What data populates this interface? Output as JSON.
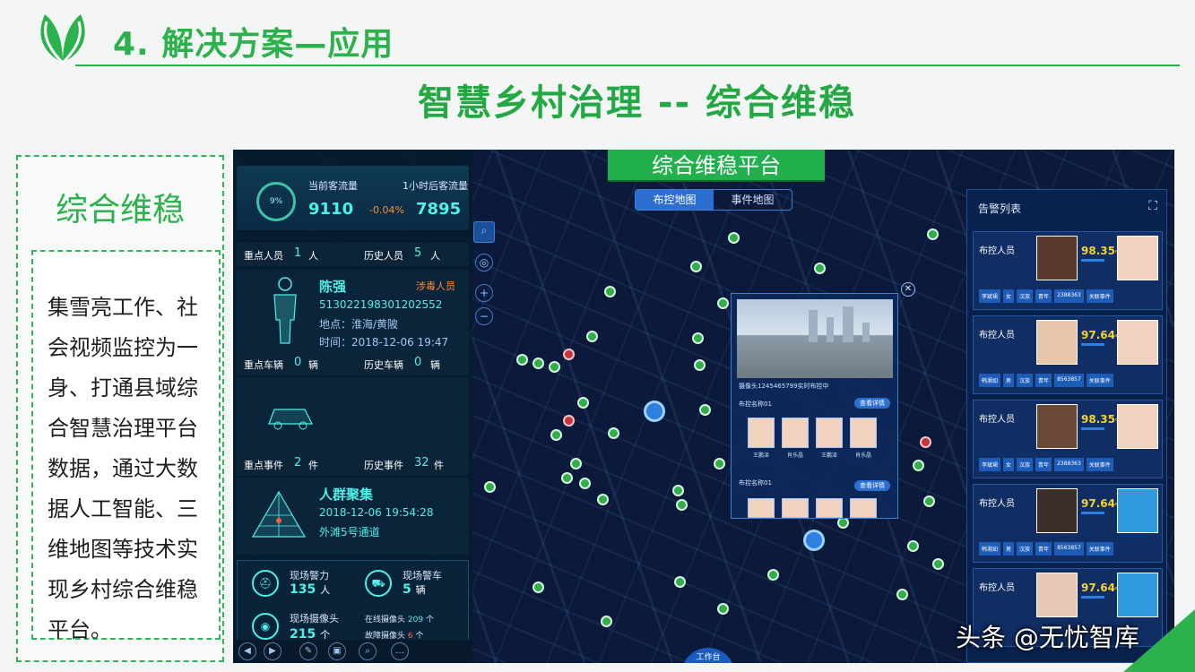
{
  "slide": {
    "title": "4. 解决方案—应用",
    "subtitle": "智慧乡村治理 -- 综合维稳"
  },
  "side": {
    "heading": "综合维稳",
    "body": "集雪亮工作、社会视频监控为一身、打通县域综合智慧治理平台数据，通过大数据人工智能、三维地图等技术实现乡村综合维稳平台。"
  },
  "platform": {
    "title": "综合维稳平台",
    "map_tabs": [
      "布控地图",
      "事件地图"
    ],
    "flow": {
      "ring": "9%",
      "current_label": "当前客流量",
      "current_value": "9110",
      "change": "-0.04%",
      "next_label": "1小时后客流量",
      "next_value": "7895"
    },
    "key_person": {
      "label": "重点人员",
      "count": "1",
      "unit": "人",
      "hist_label": "历史人员",
      "hist_count": "5",
      "hist_unit": "人"
    },
    "person_card": {
      "name": "陈强",
      "tag": "涉毒人员",
      "id": "513022198301202552",
      "address": "地点：淮海/黄陂",
      "time": "时间：2018-12-06 19:47"
    },
    "key_vehicle": {
      "label": "重点车辆",
      "count": "0",
      "unit": "辆",
      "hist_label": "历史车辆",
      "hist_count": "0",
      "hist_unit": "辆"
    },
    "key_event": {
      "label": "重点事件",
      "count": "2",
      "unit": "件",
      "hist_label": "历史事件",
      "hist_count": "32",
      "hist_unit": "件"
    },
    "event_card": {
      "name": "人群聚集",
      "time": "2018-12-06 19:54:28",
      "place": "外滩5号通道"
    },
    "stats": {
      "police_label": "现场警力",
      "police_value": "135",
      "police_unit": "人",
      "car_label": "现场警车",
      "car_value": "5",
      "car_unit": "辆",
      "cam_label": "现场摄像头",
      "cam_value": "215",
      "cam_unit": "个",
      "online_label": "在线摄像头",
      "online_value": "209",
      "online_unit": "个",
      "fault_label": "故障摄像头",
      "fault_value": "6",
      "fault_unit": "个"
    },
    "popup": {
      "camera": "摄像头1245465799实时布控中",
      "group1": "布控名称01",
      "group2": "布控名称01",
      "view": "查看详情",
      "faces1": [
        "王鹏泽",
        "肖乐晶",
        "王鹏泽",
        "肖乐晶"
      ]
    },
    "alarms": {
      "title": "告警列表",
      "items": [
        {
          "label": "布控人员",
          "score": "98.35",
          "tags": [
            "李斌珺",
            "女",
            "汉族",
            "青年",
            "2388363",
            "关联事件"
          ]
        },
        {
          "label": "布控人员",
          "score": "97.64",
          "tags": [
            "韩湘如",
            "男",
            "汉族",
            "青年",
            "8563857",
            "关联事件"
          ]
        },
        {
          "label": "布控人员",
          "score": "98.35",
          "tags": [
            "李斌珺",
            "女",
            "汉族",
            "青年",
            "2388363",
            "关联事件"
          ]
        },
        {
          "label": "布控人员",
          "score": "97.64",
          "tags": [
            "韩湘如",
            "男",
            "汉族",
            "青年",
            "8563857",
            "关联事件"
          ]
        },
        {
          "label": "布控人员",
          "score": "97.64",
          "tags": []
        }
      ]
    },
    "bottom_button": "工作台"
  },
  "watermark": "头条 @无忧智库",
  "colors": {
    "brand_green": "#2bb24c",
    "dashboard_bg": "#0b1a3a",
    "accent_cyan": "#4ef0e8"
  }
}
